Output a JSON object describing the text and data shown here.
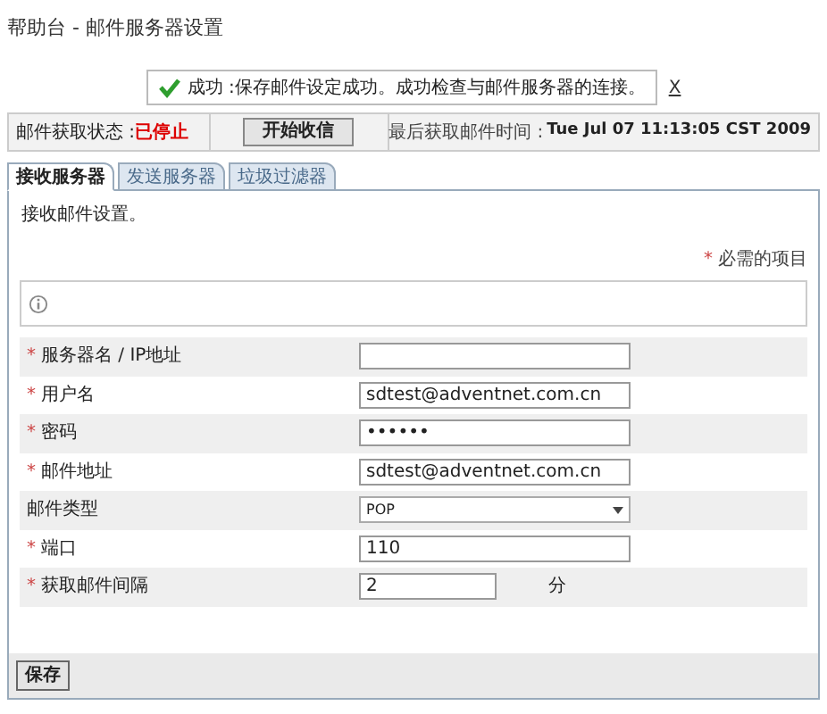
{
  "page_title": "帮助台 - 邮件服务器设置",
  "message": {
    "kind": "success",
    "label": "成功",
    "text": ":保存邮件设定成功。成功检查与邮件服务器的连接。",
    "close": "X"
  },
  "status_bar": {
    "status_label": "邮件获取状态 :",
    "status_value": "已停止",
    "button": "开始收信",
    "time_label": "最后获取邮件时间 :",
    "time_value": "Tue Jul 07 11:13:05 CST 2009"
  },
  "tabs": [
    {
      "label": "接收服务器",
      "selected": true
    },
    {
      "label": "发送服务器",
      "selected": false
    },
    {
      "label": "垃圾过滤器",
      "selected": false
    }
  ],
  "section_title": "接收邮件设置。",
  "required_mark": "*",
  "required_note": "必需的项目",
  "fields": [
    {
      "label": "服务器名 / IP地址",
      "required": true,
      "kind": "text"
    },
    {
      "label": "用户名",
      "required": true,
      "kind": "text",
      "value": "sdtest@adventnet.com.cn"
    },
    {
      "label": "密码",
      "required": true,
      "kind": "text",
      "value": "••••••"
    },
    {
      "label": "邮件地址",
      "required": true,
      "kind": "text",
      "value": "sdtest@adventnet.com.cn"
    },
    {
      "label": "邮件类型",
      "required": false,
      "kind": "select",
      "value": "POP"
    },
    {
      "label": "端口",
      "required": true,
      "kind": "text",
      "value": "110"
    },
    {
      "label": "获取邮件间隔",
      "required": true,
      "kind": "short",
      "value": "2",
      "unit": "分"
    }
  ],
  "save_button": "保存"
}
